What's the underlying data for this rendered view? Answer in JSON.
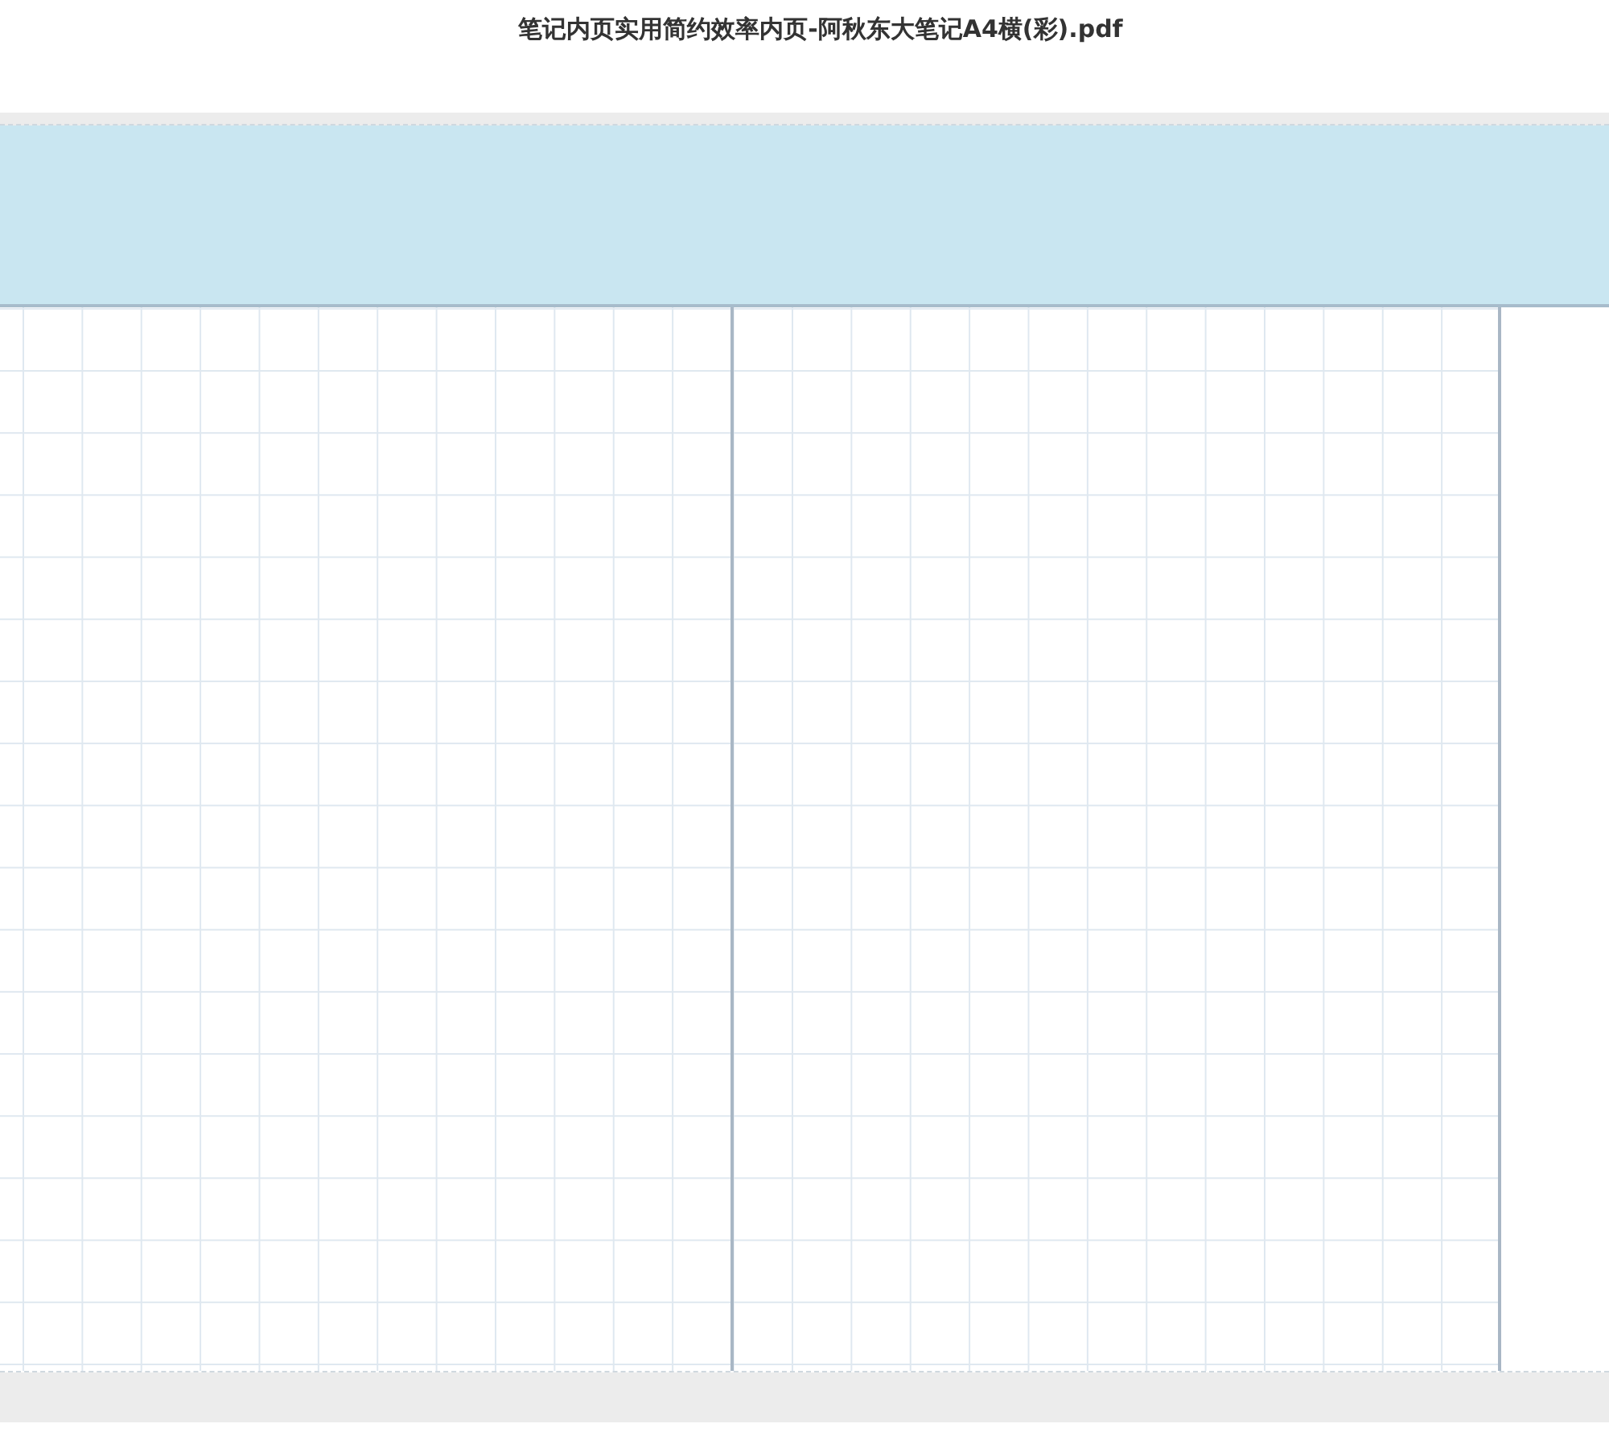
{
  "document": {
    "title": "笔记内页实用简约效率内页-阿秋东大笔记A4横(彩).pdf"
  }
}
